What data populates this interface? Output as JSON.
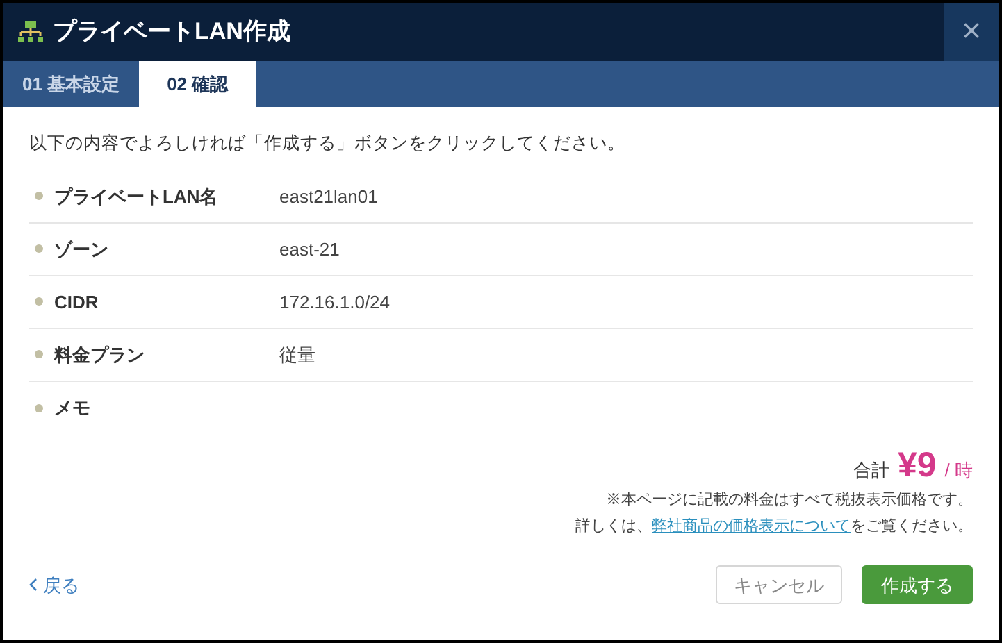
{
  "window": {
    "title": "プライベートLAN作成",
    "close": "×"
  },
  "tabs": [
    {
      "label": "01 基本設定",
      "selected": false
    },
    {
      "label": "02 確認",
      "selected": true
    }
  ],
  "message": "以下の内容でよろしければ「作成する」ボタンをクリックしてください。",
  "rows": [
    {
      "label": "プライベートLAN名",
      "value": "east21lan01"
    },
    {
      "label": "ゾーン",
      "value": "east-21"
    },
    {
      "label": "CIDR",
      "value": "172.16.1.0/24"
    },
    {
      "label": "料金プラン",
      "value": "従量"
    },
    {
      "label": "メモ"
    }
  ],
  "total": {
    "label": "合計",
    "amount": "¥9",
    "unit": "/ 時"
  },
  "notes": {
    "line1": "※本ページに記載の料金はすべて税抜表示価格です。",
    "prefix": "詳しくは、",
    "link": "弊社商品の価格表示について",
    "suffix": "をご覧ください。"
  },
  "footer": {
    "back": "戻る",
    "cancel": "キャンセル",
    "submit": "作成する"
  }
}
